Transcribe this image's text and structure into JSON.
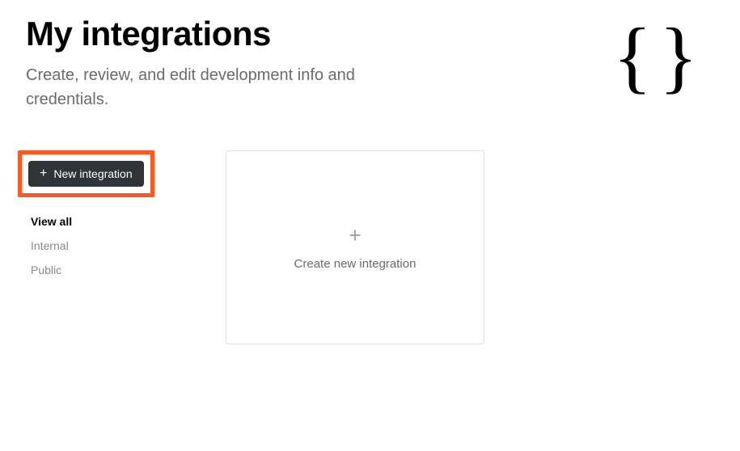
{
  "header": {
    "title": "My integrations",
    "subtitle": "Create, review, and edit development info and credentials."
  },
  "sidebar": {
    "new_button_label": "New integration",
    "filters": {
      "view_all": "View all",
      "internal": "Internal",
      "public": "Public"
    }
  },
  "card": {
    "label": "Create new integration"
  }
}
